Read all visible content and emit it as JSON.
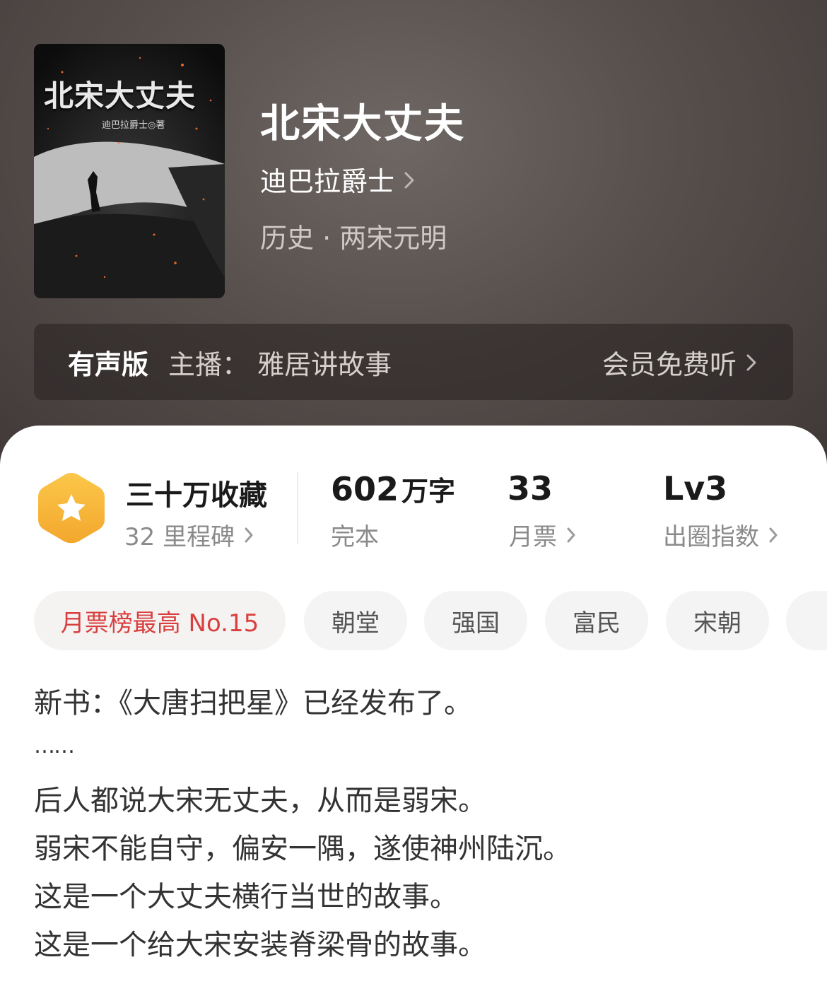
{
  "book": {
    "title": "北宋大丈夫",
    "author": "迪巴拉爵士",
    "genre": "历史 · 两宋元明",
    "cover": {
      "title": "北宋大丈夫",
      "author_line": "迪巴拉爵士◎著"
    }
  },
  "audio": {
    "tag": "有声版",
    "host": "主播：  雅居讲故事",
    "action": "会员免费听"
  },
  "stats": {
    "collect": {
      "value": "三十万收藏",
      "sub": "32 里程碑"
    },
    "words": {
      "number": "602",
      "unit": "万字",
      "sub": "完本"
    },
    "votes": {
      "value": "33",
      "sub": "月票"
    },
    "level": {
      "value": "Lv3",
      "sub": "出圈指数"
    }
  },
  "tags": [
    "月票榜最高 No.15",
    "朝堂",
    "强国",
    "富民",
    "宋朝"
  ],
  "description": [
    "新书：《大唐扫把星》已经发布了。",
    "……",
    "后人都说大宋无丈夫，从而是弱宋。",
    "弱宋不能自守，偏安一隅，遂使神州陆沉。",
    "这是一个大丈夫横行当世的故事。",
    "这是一个给大宋安装脊梁骨的故事。"
  ],
  "colors": {
    "hero_bg": "#574f4c",
    "accent_red": "#d8403f",
    "badge_orange": "#f6b73c"
  },
  "icons": [
    "chevron-right-icon",
    "star-badge-icon"
  ]
}
